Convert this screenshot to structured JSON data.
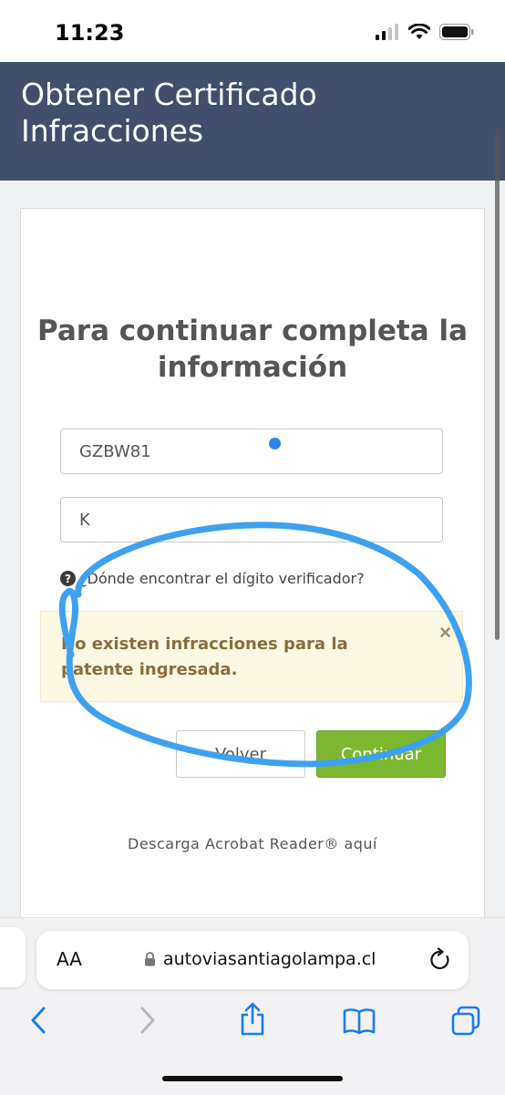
{
  "status_bar": {
    "time": "11:23"
  },
  "header": {
    "title": "Obtener Certificado Infracciones"
  },
  "form": {
    "heading": "Para continuar completa la información",
    "plate_value": "GZBW81",
    "check_digit_value": "K",
    "help_link": "¿Dónde encontrar el dígito verificador?"
  },
  "alert": {
    "message": "No existen infracciones para la patente ingresada.",
    "close": "×"
  },
  "buttons": {
    "back": "Volver",
    "continue": "Continuar"
  },
  "footer_link": "Descarga Acrobat Reader® aquí",
  "browser": {
    "text_size": "AA",
    "url": "autoviasantiagolampa.cl"
  },
  "colors": {
    "header_bg": "#414e6c",
    "accent_green": "#7cb82f",
    "alert_bg": "#fcf8e3",
    "alert_text": "#8a6d3b",
    "ios_blue": "#1a7cf0",
    "annotation": "#3ea1f0"
  },
  "icons": [
    "signal-icon",
    "wifi-icon",
    "battery-icon",
    "question-icon",
    "close-icon",
    "lock-icon",
    "reload-icon",
    "back-arrow-icon",
    "forward-arrow-icon",
    "share-icon",
    "bookmarks-icon",
    "tabs-icon"
  ]
}
